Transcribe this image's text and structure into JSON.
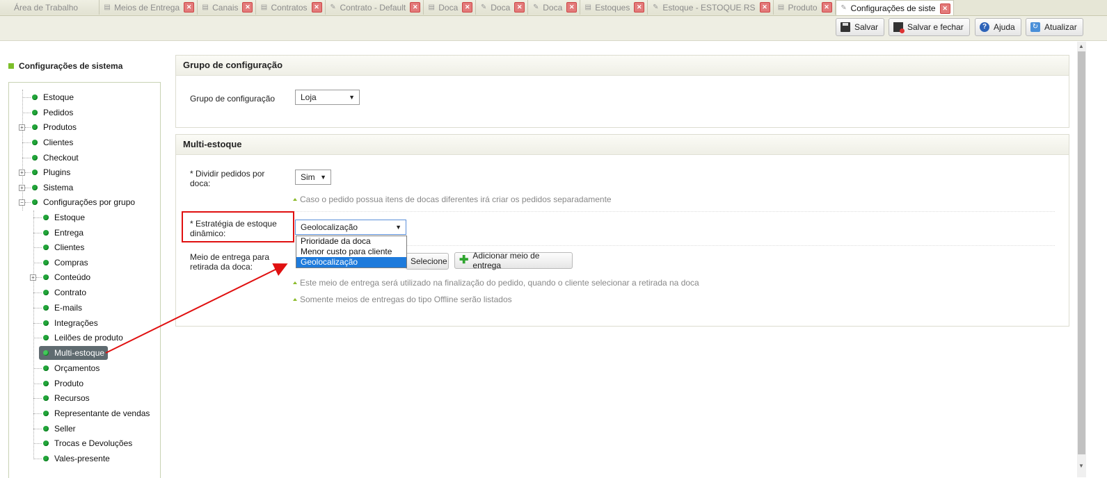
{
  "tabs": [
    {
      "label": "Área de Trabalho",
      "icon": "",
      "closable": false,
      "active": false
    },
    {
      "label": "Meios de Entrega",
      "icon": "document-icon",
      "closable": true,
      "active": false
    },
    {
      "label": "Canais",
      "icon": "document-icon",
      "closable": true,
      "active": false
    },
    {
      "label": "Contratos",
      "icon": "document-icon",
      "closable": true,
      "active": false
    },
    {
      "label": "Contrato - Default",
      "icon": "pencil-icon",
      "closable": true,
      "active": false
    },
    {
      "label": "Doca",
      "icon": "document-icon",
      "closable": true,
      "active": false
    },
    {
      "label": "Doca",
      "icon": "pencil-icon",
      "closable": true,
      "active": false
    },
    {
      "label": "Doca",
      "icon": "pencil-icon",
      "closable": true,
      "active": false
    },
    {
      "label": "Estoques",
      "icon": "document-icon",
      "closable": true,
      "active": false
    },
    {
      "label": "Estoque - ESTOQUE RS",
      "icon": "pencil-icon",
      "closable": true,
      "active": false
    },
    {
      "label": "Produto",
      "icon": "document-icon",
      "closable": true,
      "active": false
    },
    {
      "label": "Configurações de siste",
      "icon": "pencil-icon",
      "closable": true,
      "active": true
    }
  ],
  "toolbar": {
    "save": "Salvar",
    "save_close": "Salvar e fechar",
    "help": "Ajuda",
    "refresh": "Atualizar"
  },
  "sidebar": {
    "title": "Configurações de sistema",
    "items": [
      {
        "label": "Estoque"
      },
      {
        "label": "Pedidos"
      },
      {
        "label": "Produtos"
      },
      {
        "label": "Clientes"
      },
      {
        "label": "Checkout"
      },
      {
        "label": "Plugins"
      },
      {
        "label": "Sistema"
      },
      {
        "label": "Configurações por grupo"
      }
    ],
    "subitems": [
      {
        "label": "Estoque"
      },
      {
        "label": "Entrega"
      },
      {
        "label": "Clientes"
      },
      {
        "label": "Compras"
      },
      {
        "label": "Conteúdo"
      },
      {
        "label": "Contrato"
      },
      {
        "label": "E-mails"
      },
      {
        "label": "Integrações"
      },
      {
        "label": "Leilões de produto"
      },
      {
        "label": "Multi-estoque"
      },
      {
        "label": "Orçamentos"
      },
      {
        "label": "Produto"
      },
      {
        "label": "Recursos"
      },
      {
        "label": "Representante de vendas"
      },
      {
        "label": "Seller"
      },
      {
        "label": "Trocas e Devoluções"
      },
      {
        "label": "Vales-presente"
      }
    ]
  },
  "group_section": {
    "title": "Grupo de configuração",
    "field_label": "Grupo de configuração",
    "field_value": "Loja"
  },
  "multi_section": {
    "title": "Multi-estoque",
    "split_label_1": "* Dividir pedidos por",
    "split_label_2": "doca:",
    "split_value": "Sim",
    "split_hint": "Caso o pedido possua itens de docas diferentes irá criar os pedidos separadamente",
    "strategy_label_1": "* Estratégia de estoque",
    "strategy_label_2": "dinâmico:",
    "strategy_value": "Geolocalização",
    "strategy_options": [
      "Prioridade da doca",
      "Menor custo para cliente",
      "Geolocalização"
    ],
    "pickup_label_1": "Meio de entrega para",
    "pickup_label_2": "retirada da doca:",
    "select_button": "Selecione",
    "add_button": "Adicionar meio de entrega",
    "pickup_hint_1": "Este meio de entrega será utilizado na finalização do pedido, quando o cliente selecionar a retirada na doca",
    "pickup_hint_2": "Somente meios de entregas do tipo Offline serão listados"
  },
  "colors": {
    "annotation": "#e01010",
    "status_dot": "#22a53a",
    "accent": "#7cbf2a"
  }
}
